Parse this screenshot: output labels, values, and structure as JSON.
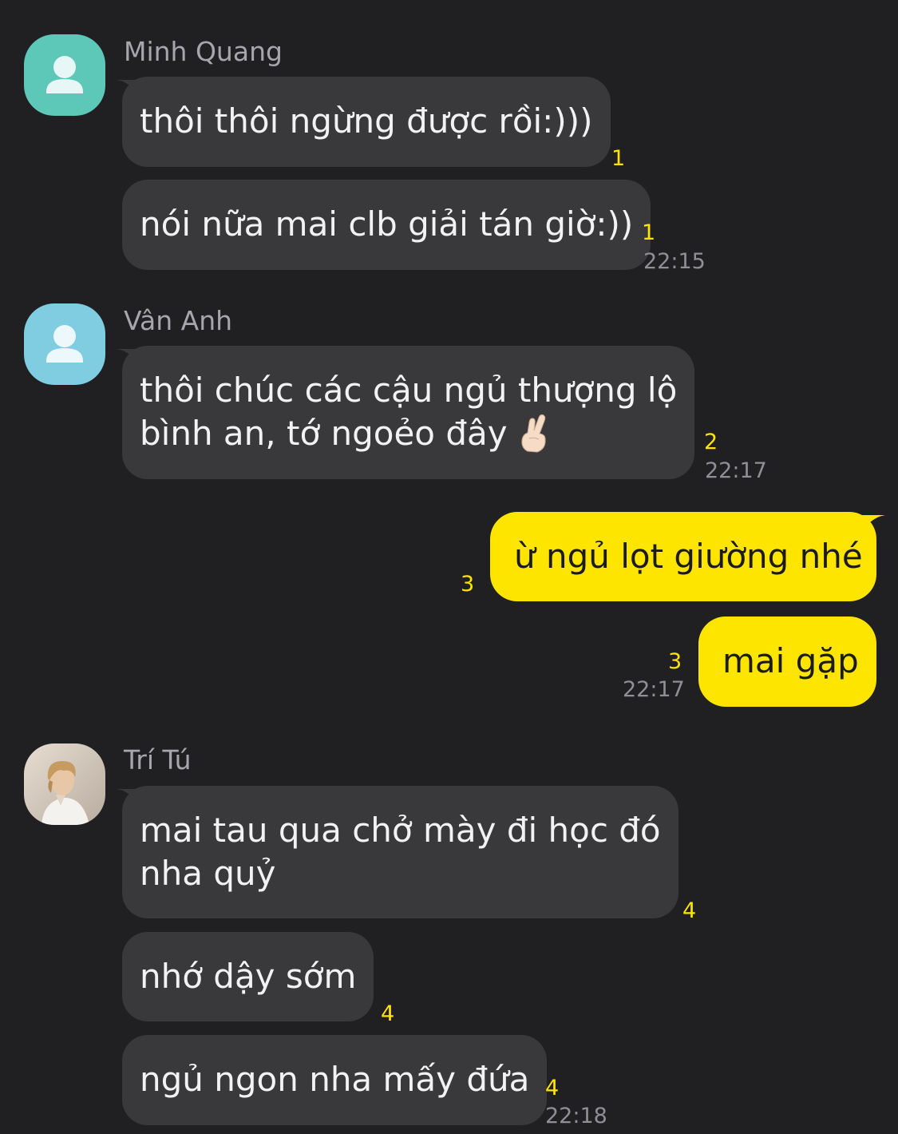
{
  "groups": [
    {
      "sender": "Minh Quang",
      "messages": [
        {
          "text": "thôi thôi ngừng được rồi:)))",
          "unread": "1"
        },
        {
          "text": "nói nữa mai clb giải tán giờ:))",
          "unread": "1",
          "time": "22:15"
        }
      ]
    },
    {
      "sender": "Vân Anh",
      "messages": [
        {
          "line1": "thôi chúc các cậu ngủ thượng lộ",
          "line2": "bình an, tớ ngoẻo đây",
          "emoji": "crossed-fingers-emoji",
          "unread": "2",
          "time": "22:17"
        }
      ]
    },
    {
      "sender": "me",
      "messages": [
        {
          "text": "ừ ngủ lọt giường nhé",
          "unread": "3"
        },
        {
          "text": "mai gặp",
          "unread": "3",
          "time": "22:17"
        }
      ]
    },
    {
      "sender": "Trí Tú",
      "messages": [
        {
          "line1": "mai tau qua chở mày đi học đó",
          "line2": "nha quỷ",
          "unread": "4"
        },
        {
          "text": "nhớ dậy sớm",
          "unread": "4"
        },
        {
          "text": "ngủ ngon nha mấy đứa",
          "unread": "4",
          "time": "22:18"
        }
      ]
    }
  ],
  "colors": {
    "background": "#202023",
    "incoming_bubble": "#39393c",
    "outgoing_bubble": "#fee500",
    "unread_count": "#fee500",
    "avatar_minh_quang": "#5ec8b8",
    "avatar_van_anh": "#80cde2"
  }
}
